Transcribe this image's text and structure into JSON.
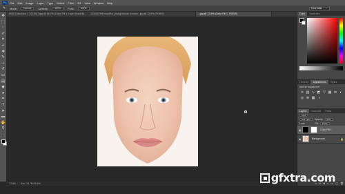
{
  "menubar": {
    "logo": "Ps",
    "items": [
      "File",
      "Edit",
      "Image",
      "Layer",
      "Type",
      "Select",
      "Filter",
      "3D",
      "View",
      "Window",
      "Help"
    ]
  },
  "options": {
    "tool_glyph": "✎",
    "mode_label": "Mode:",
    "mode_value": "Normal",
    "opacity_label": "Opacity:",
    "opacity_value": "100%",
    "flow_label": "Flow:",
    "flow_value": "100%",
    "workspace": "Essentials"
  },
  "tabs": [
    {
      "label": "6658 Calculator 1 1234567.jpg @ 16,7% (Color Fill 1, Layer Mask/8)",
      "active": false
    },
    {
      "label": "123456789 beautiful_young blonde woman...jpg @ 12,5% (RGB/8)",
      "active": false
    },
    {
      "label": "...jpg @ 12,5% (Color Fill 1, RGB/8)",
      "active": true
    }
  ],
  "status": {
    "zoom": "12,5%",
    "doc": "Doc: 24,7M/49,4M"
  },
  "panels": {
    "color_tabs": [
      "Color",
      "Swatches"
    ],
    "adj_tabs": [
      "Libraries",
      "Adjustments",
      "Styles"
    ],
    "adj_heading": "Add an adjustment",
    "layers_tabs": [
      "Layers",
      "Channels",
      "Paths"
    ],
    "kind_label": "Kind",
    "blend_value": "Soft Light",
    "opacity_label": "Opacity:",
    "opacity_value": "30%",
    "lock_label": "Lock:",
    "fill_label": "Fill:",
    "fill_value": "100%",
    "layers": [
      {
        "name": "Color Fill 1",
        "selected": true
      },
      {
        "name": "Background",
        "selected": false
      }
    ]
  },
  "watermark": "gfxtra.com"
}
